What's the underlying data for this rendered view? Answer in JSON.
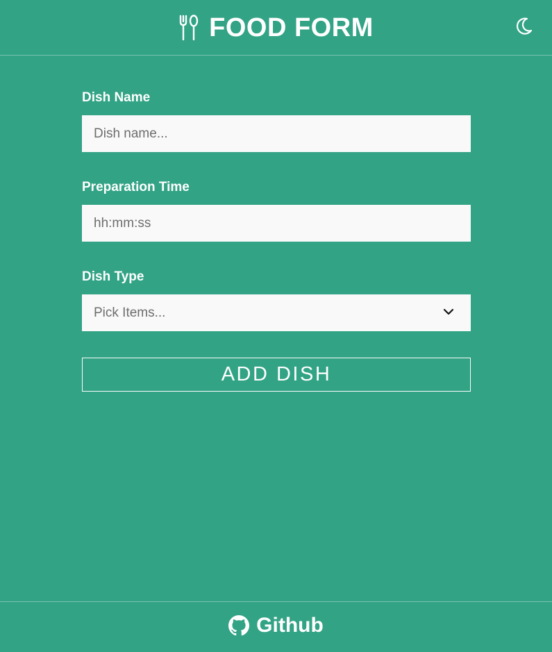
{
  "header": {
    "title": "FOOD FORM",
    "brand_icon": "fork-spoon-icon",
    "theme_toggle_icon": "moon-icon"
  },
  "form": {
    "dish_name": {
      "label": "Dish Name",
      "placeholder": "Dish name...",
      "value": ""
    },
    "preparation_time": {
      "label": "Preparation Time",
      "placeholder": "hh:mm:ss",
      "value": ""
    },
    "dish_type": {
      "label": "Dish Type",
      "selected": "Pick Items..."
    },
    "submit_label": "ADD DISH"
  },
  "footer": {
    "link_label": "Github",
    "icon": "github-icon"
  },
  "colors": {
    "background": "#32a385",
    "input_background": "#f9f9f9",
    "text": "#ffffff"
  }
}
